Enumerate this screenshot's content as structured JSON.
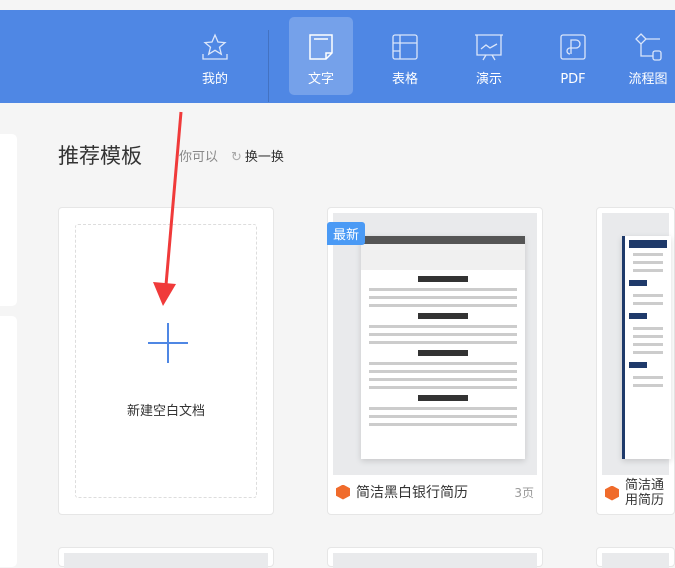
{
  "nav": [
    {
      "label": "我的",
      "icon": "star-icon"
    },
    {
      "label": "文字",
      "icon": "document-icon",
      "active": true
    },
    {
      "label": "表格",
      "icon": "table-icon"
    },
    {
      "label": "演示",
      "icon": "presentation-icon"
    },
    {
      "label": "PDF",
      "icon": "pdf-icon"
    },
    {
      "label": "流程图",
      "icon": "flowchart-icon"
    }
  ],
  "section": {
    "title": "推荐模板",
    "hint": "你可以",
    "refresh": "换一换"
  },
  "new_doc": {
    "label": "新建空白文档"
  },
  "templates": [
    {
      "name": "简洁黑白银行简历",
      "pages": "3页",
      "badge": "最新"
    },
    {
      "name": "简洁通用简历"
    }
  ],
  "colors": {
    "accent": "#4f87e4",
    "arrow": "#f03a3a"
  }
}
